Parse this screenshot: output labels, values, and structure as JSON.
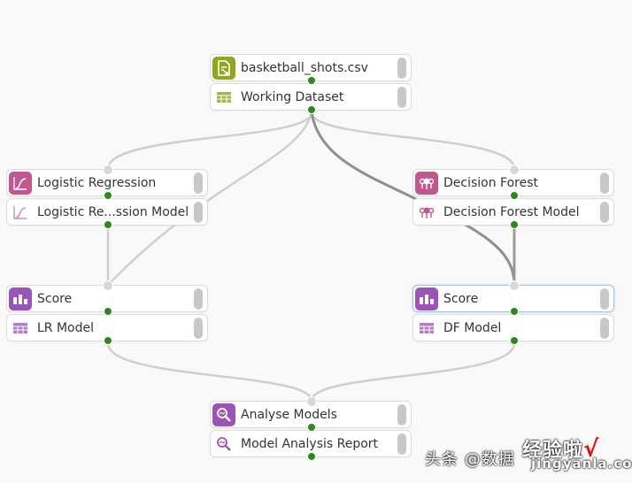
{
  "canvas": {
    "nodes": [
      {
        "id": "source",
        "title": "basketball_shots.csv",
        "output": "Working Dataset",
        "color": "#8fa61d",
        "icon": "csv-file-icon",
        "output_icon": "table-icon"
      },
      {
        "id": "lr",
        "title": "Logistic Regression",
        "output": "Logistic Re...ssion Model",
        "color": "#c0578f",
        "icon": "logistic-curve-icon",
        "output_icon": "logistic-curve-icon"
      },
      {
        "id": "df",
        "title": "Decision Forest",
        "output": "Decision Forest Model",
        "color": "#c0578f",
        "icon": "forest-icon",
        "output_icon": "forest-icon"
      },
      {
        "id": "score_lr",
        "title": "Score",
        "output": "LR Model",
        "color": "#9a54b8",
        "icon": "score-icon",
        "output_icon": "table-icon"
      },
      {
        "id": "score_df",
        "title": "Score",
        "output": "DF Model",
        "color": "#9a54b8",
        "icon": "score-icon",
        "output_icon": "table-icon",
        "selected": true
      },
      {
        "id": "analyse",
        "title": "Analyse Models",
        "output": "Model Analysis Report",
        "color": "#9a54b8",
        "icon": "analyse-magnifier-icon",
        "output_icon": "analyse-magnifier-icon"
      }
    ],
    "connections": [
      {
        "from": "source",
        "to": "lr",
        "style": "light"
      },
      {
        "from": "source",
        "to": "lr_model_train",
        "style": "light"
      },
      {
        "from": "source",
        "to": "df",
        "style": "light"
      },
      {
        "from": "source",
        "to": "df_model_train",
        "style": "dark"
      },
      {
        "from": "lr",
        "to": "score_lr",
        "style": "light"
      },
      {
        "from": "df",
        "to": "score_df",
        "style": "dark"
      },
      {
        "from": "score_lr",
        "to": "analyse",
        "style": "light"
      },
      {
        "from": "score_df",
        "to": "analyse",
        "style": "light"
      }
    ]
  },
  "watermark": {
    "line1": "头条 @数据",
    "line2": "经验啦",
    "line3": "jingyanla.com",
    "check": "√"
  }
}
